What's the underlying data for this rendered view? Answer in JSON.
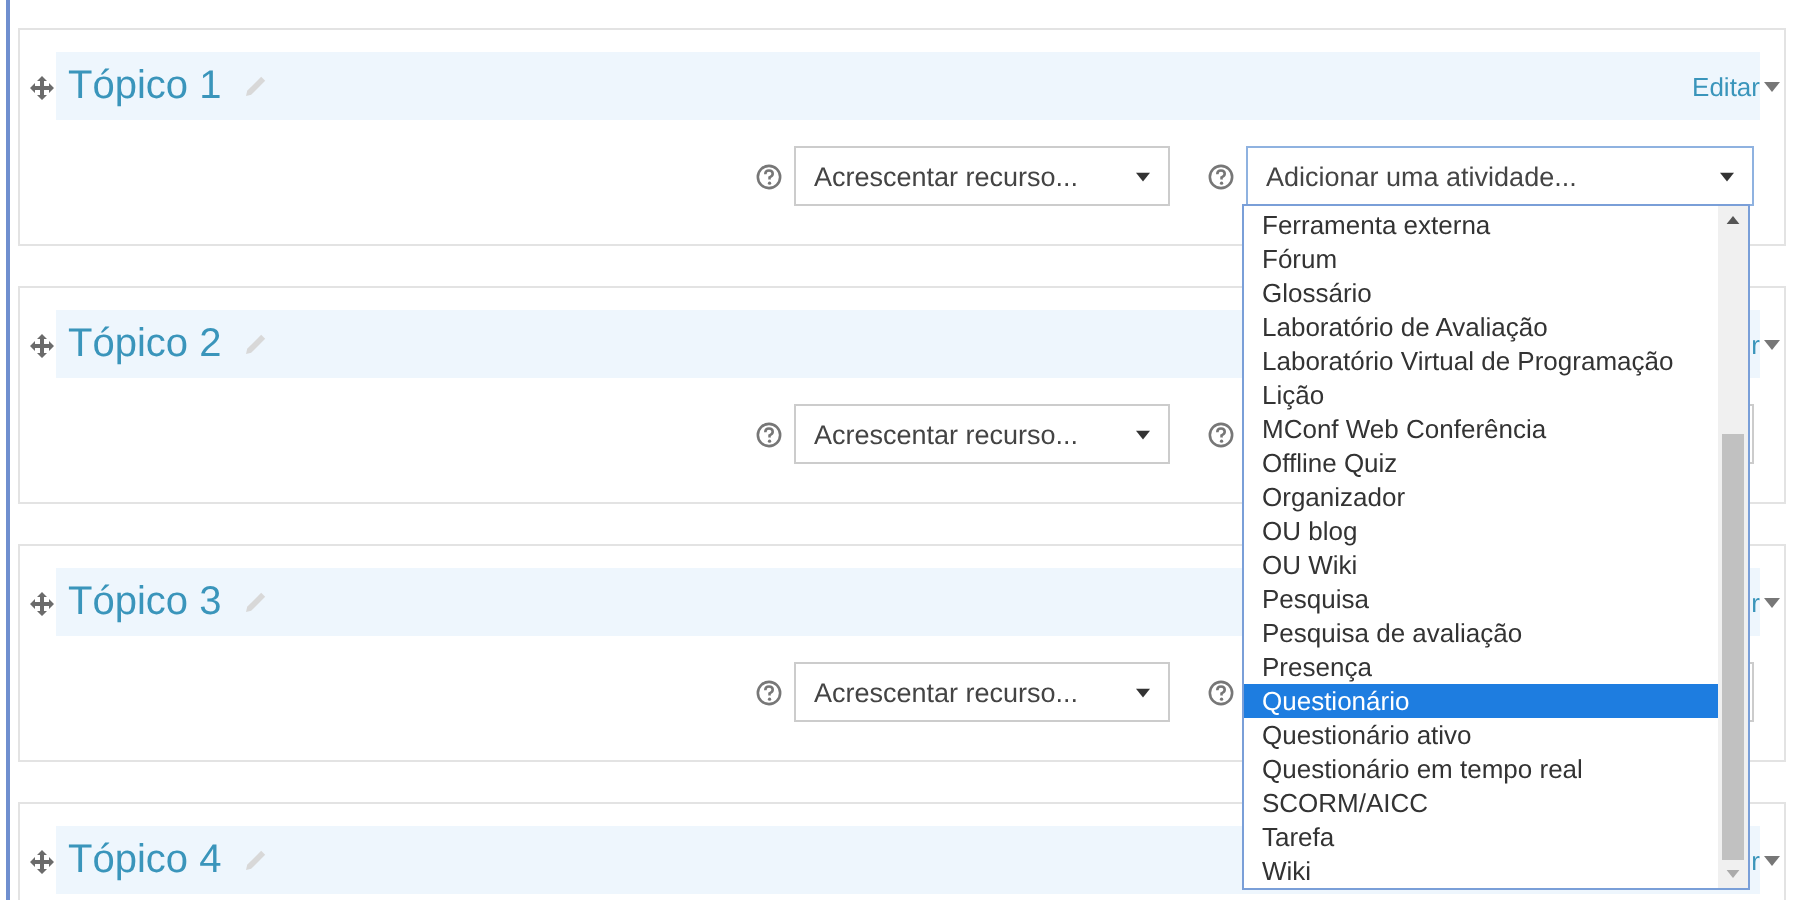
{
  "sections": [
    {
      "title": "Tópico 1",
      "edit_label": "Editar",
      "resource_select": "Acrescentar recurso...",
      "activity_select": "Adicionar uma atividade..."
    },
    {
      "title": "Tópico 2",
      "edit_label": "r",
      "resource_select": "Acrescentar recurso..."
    },
    {
      "title": "Tópico 3",
      "edit_label": "r",
      "resource_select": "Acrescentar recurso..."
    },
    {
      "title": "Tópico 4",
      "edit_label": "r"
    }
  ],
  "activity_dropdown": {
    "options": [
      {
        "label": "Ferramenta externa",
        "selected": false
      },
      {
        "label": "Fórum",
        "selected": false
      },
      {
        "label": "Glossário",
        "selected": false
      },
      {
        "label": "Laboratório de Avaliação",
        "selected": false
      },
      {
        "label": "Laboratório Virtual de Programação",
        "selected": false
      },
      {
        "label": "Lição",
        "selected": false
      },
      {
        "label": "MConf Web Conferência",
        "selected": false
      },
      {
        "label": "Offline Quiz",
        "selected": false
      },
      {
        "label": "Organizador",
        "selected": false
      },
      {
        "label": "OU blog",
        "selected": false
      },
      {
        "label": "OU Wiki",
        "selected": false
      },
      {
        "label": "Pesquisa",
        "selected": false
      },
      {
        "label": "Pesquisa de avaliação",
        "selected": false
      },
      {
        "label": "Presença",
        "selected": false
      },
      {
        "label": "Questionário",
        "selected": true
      },
      {
        "label": "Questionário ativo",
        "selected": false
      },
      {
        "label": "Questionário em tempo real",
        "selected": false
      },
      {
        "label": "SCORM/AICC",
        "selected": false
      },
      {
        "label": "Tarefa",
        "selected": false
      },
      {
        "label": "Wiki",
        "selected": false
      }
    ]
  }
}
